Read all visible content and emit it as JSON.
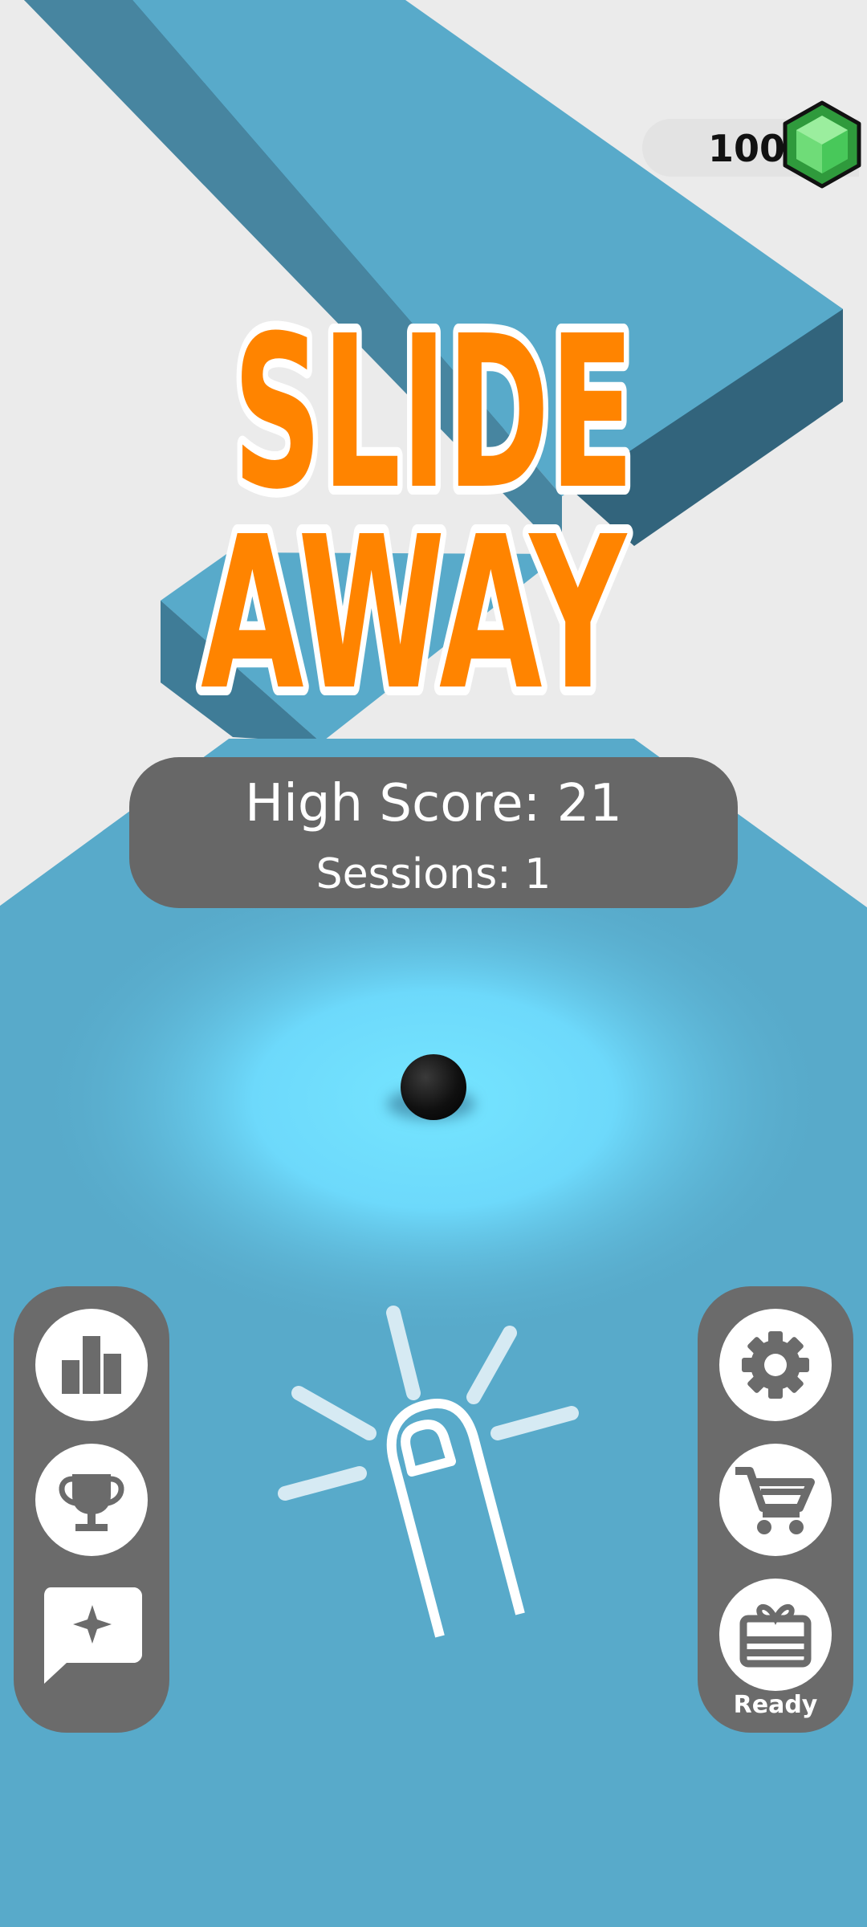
{
  "hud": {
    "gem_count": "100"
  },
  "title": {
    "line1": "SLIDE",
    "line2": "AWAY"
  },
  "score_panel": {
    "high_score": "High Score: 21",
    "sessions": "Sessions: 1"
  },
  "left_menu": {
    "buttons": [
      {
        "icon": "leaderboard-icon"
      },
      {
        "icon": "trophy-icon"
      },
      {
        "icon": "feedback-icon"
      }
    ]
  },
  "right_menu": {
    "buttons": [
      {
        "icon": "gear-icon"
      },
      {
        "icon": "shopping-cart-icon"
      },
      {
        "icon": "gift-icon"
      }
    ],
    "gift_status": "Ready"
  },
  "colors": {
    "background": "#ebebeb",
    "track_top": "#58aaca",
    "track_side": "#32647c",
    "title_fill": "#ff8400",
    "panel": "#676767",
    "gem_green": "#3fc25b"
  }
}
